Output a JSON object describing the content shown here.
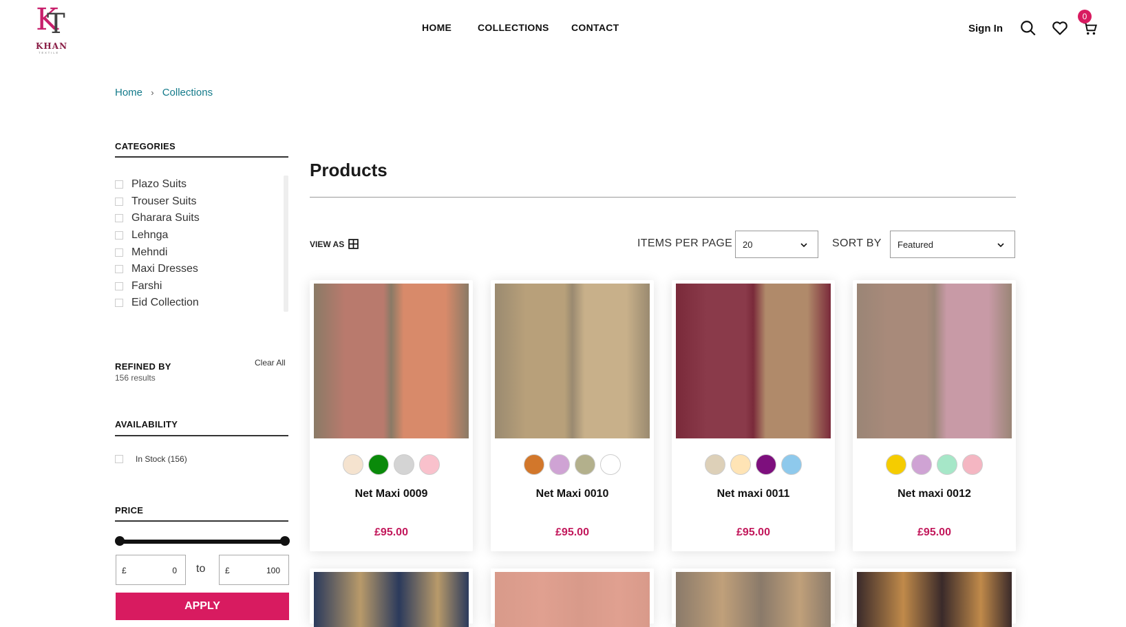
{
  "header": {
    "logo_mono": "K",
    "logo_mono2": "T",
    "logo_word": "KHAN",
    "logo_sub": "TEXTILE",
    "nav": [
      "HOME",
      "COLLECTIONS",
      "CONTACT"
    ],
    "signin": "Sign In",
    "cart_count": "0"
  },
  "breadcrumb": {
    "home": "Home",
    "sep": "›",
    "current": "Collections"
  },
  "sidebar": {
    "categories_title": "CATEGORIES",
    "categories": [
      "Plazo Suits",
      "Trouser Suits",
      "Gharara Suits",
      "Lehnga",
      "Mehndi",
      "Maxi Dresses",
      "Farshi",
      "Eid Collection"
    ],
    "refined_title": "REFINED BY",
    "clear_all": "Clear All",
    "results": "156 results",
    "availability_title": "AVAILABILITY",
    "in_stock": "In Stock (156)",
    "price_title": "PRICE",
    "price_currency": "£",
    "price_min": "0",
    "price_max": "100",
    "price_to": "to",
    "apply": "APPLY"
  },
  "main": {
    "title": "Products",
    "view_as": "VIEW AS",
    "items_per_page_label": "ITEMS PER PAGE",
    "items_per_page": "20",
    "sort_by_label": "SORT BY",
    "sort_by": "Featured"
  },
  "products": [
    {
      "name": "Net Maxi 0009",
      "price": "£95.00",
      "swatches": [
        "#f5e3cf",
        "#0a8a0a",
        "#d4d4d4",
        "#f9c1cc"
      ],
      "img": [
        "#b97a6d",
        "#d88a6a",
        "#8a7a66"
      ]
    },
    {
      "name": "Net Maxi 0010",
      "price": "£95.00",
      "swatches": [
        "#d2772b",
        "#cfa3d4",
        "#b3b08c",
        "#ffffff"
      ],
      "img": [
        "#b8a07a",
        "#c8b08a",
        "#9a8a70"
      ]
    },
    {
      "name": "Net maxi 0011",
      "price": "£95.00",
      "swatches": [
        "#ddd0b8",
        "#ffe4b5",
        "#7d0f7d",
        "#8ec9ec"
      ],
      "img": [
        "#8a3a4a",
        "#b08a6a",
        "#7a2a3a"
      ]
    },
    {
      "name": "Net maxi 0012",
      "price": "£95.00",
      "swatches": [
        "#f5cc00",
        "#cfa3d4",
        "#a6e7c8",
        "#f4b6c2"
      ],
      "img": [
        "#a88a7a",
        "#c89aa6",
        "#9a8576"
      ]
    }
  ],
  "products_row2": [
    {
      "img": [
        "#2b3a5c",
        "#b89a6a"
      ]
    },
    {
      "img": [
        "#d89a8a",
        "#e0a090"
      ]
    },
    {
      "img": [
        "#8a7a6a",
        "#c0a07a"
      ]
    },
    {
      "img": [
        "#3a2a2a",
        "#c08a4a"
      ]
    }
  ]
}
